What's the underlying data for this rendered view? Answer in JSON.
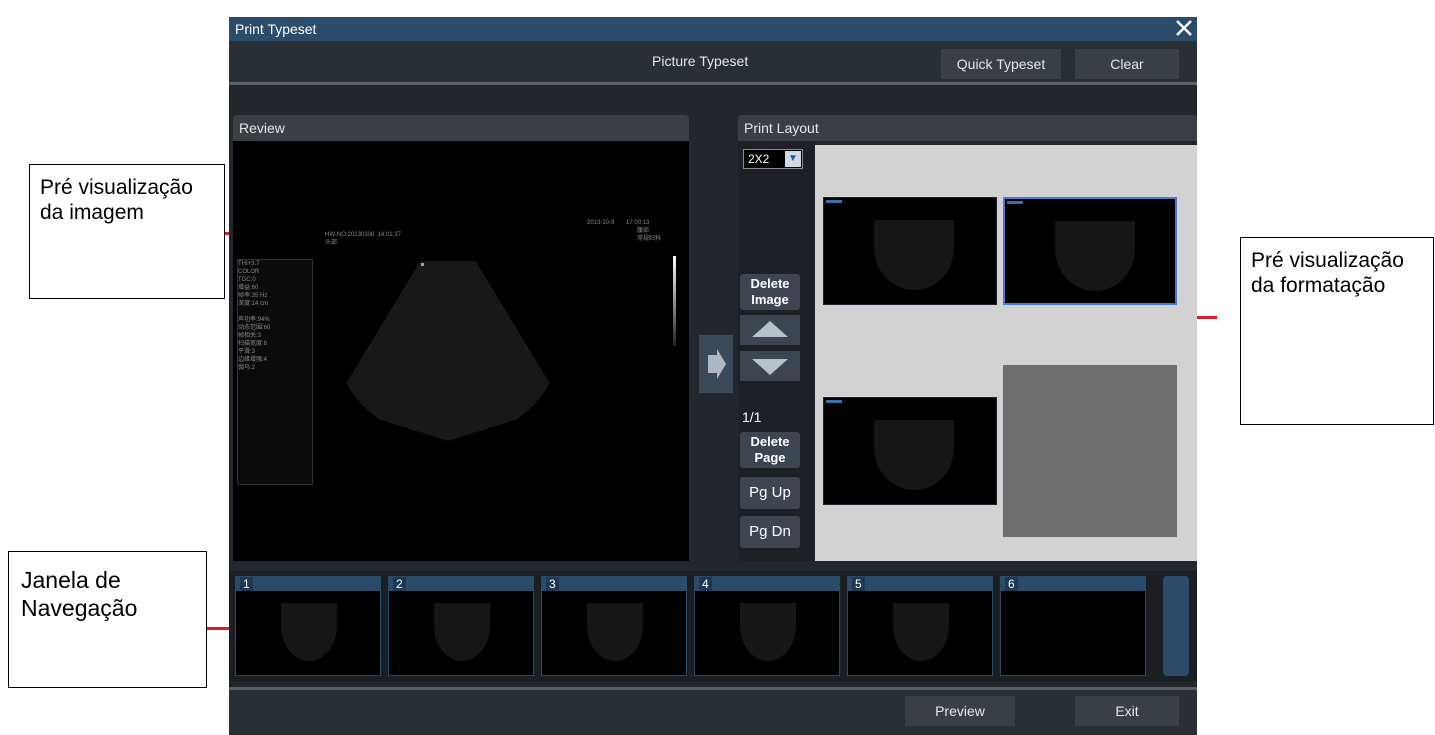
{
  "window": {
    "title": "Print Typeset"
  },
  "toolbar": {
    "center_label": "Picture Typeset",
    "quick_typeset": "Quick Typeset",
    "clear": "Clear"
  },
  "review": {
    "header": "Review"
  },
  "print_layout": {
    "header": "Print Layout",
    "layout_select": "2X2",
    "delete_image": "Delete Image",
    "page_indicator": "1/1",
    "delete_page": "Delete Page",
    "pg_up": "Pg Up",
    "pg_dn": "Pg Dn"
  },
  "navigation": {
    "thumbnails": [
      "1",
      "2",
      "3",
      "4",
      "5",
      "6"
    ]
  },
  "bottom": {
    "preview": "Preview",
    "exit": "Exit"
  },
  "callouts": {
    "image_preview": "Pré visualização da imagem",
    "format_preview": "Pré visualização da formatação",
    "nav_window": "Janela de Navegação"
  },
  "colors": {
    "title_bar": "#2b4b6a",
    "app_bg": "#23272d",
    "callout_line": "#d81f26",
    "selected_border": "#4a78d8"
  }
}
